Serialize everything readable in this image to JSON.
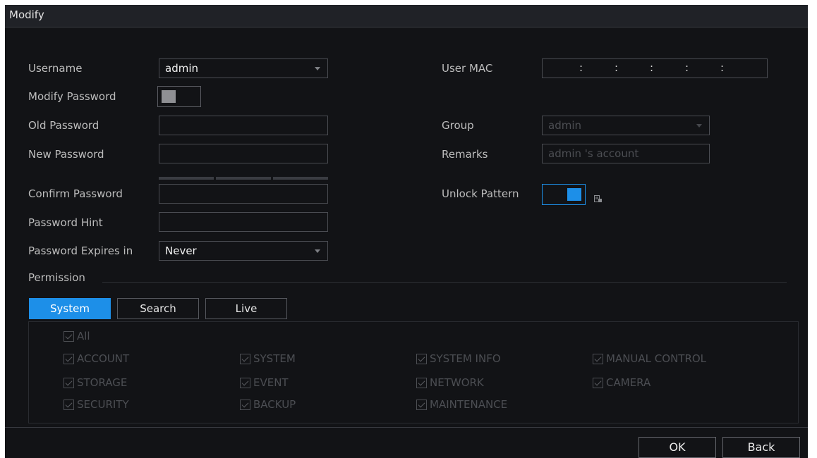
{
  "window": {
    "title": "Modify"
  },
  "form": {
    "username_label": "Username",
    "username_value": "admin",
    "modify_password_label": "Modify Password",
    "old_password_label": "Old Password",
    "new_password_label": "New Password",
    "confirm_password_label": "Confirm Password",
    "password_hint_label": "Password Hint",
    "password_expires_label": "Password Expires in",
    "password_expires_value": "Never",
    "user_mac_label": "User MAC",
    "user_mac_separator": ":",
    "group_label": "Group",
    "group_value": "admin",
    "remarks_label": "Remarks",
    "remarks_value": "admin 's account",
    "unlock_pattern_label": "Unlock Pattern",
    "modify_password_on": false,
    "unlock_pattern_on": true
  },
  "permission": {
    "section_label": "Permission",
    "tabs": [
      {
        "label": "System",
        "active": true
      },
      {
        "label": "Search",
        "active": false
      },
      {
        "label": "Live",
        "active": false
      }
    ],
    "all_label": "All",
    "items": [
      "ACCOUNT",
      "SYSTEM",
      "SYSTEM INFO",
      "MANUAL CONTROL",
      "STORAGE",
      "EVENT",
      "NETWORK",
      "CAMERA",
      "SECURITY",
      "BACKUP",
      "MAINTENANCE"
    ]
  },
  "footer": {
    "ok_label": "OK",
    "back_label": "Back"
  },
  "colors": {
    "accent": "#1d8fe8",
    "background": "#121316",
    "titlebar": "#202227"
  },
  "icons": {
    "unlock_pattern_edit": "edit-pattern-icon"
  }
}
